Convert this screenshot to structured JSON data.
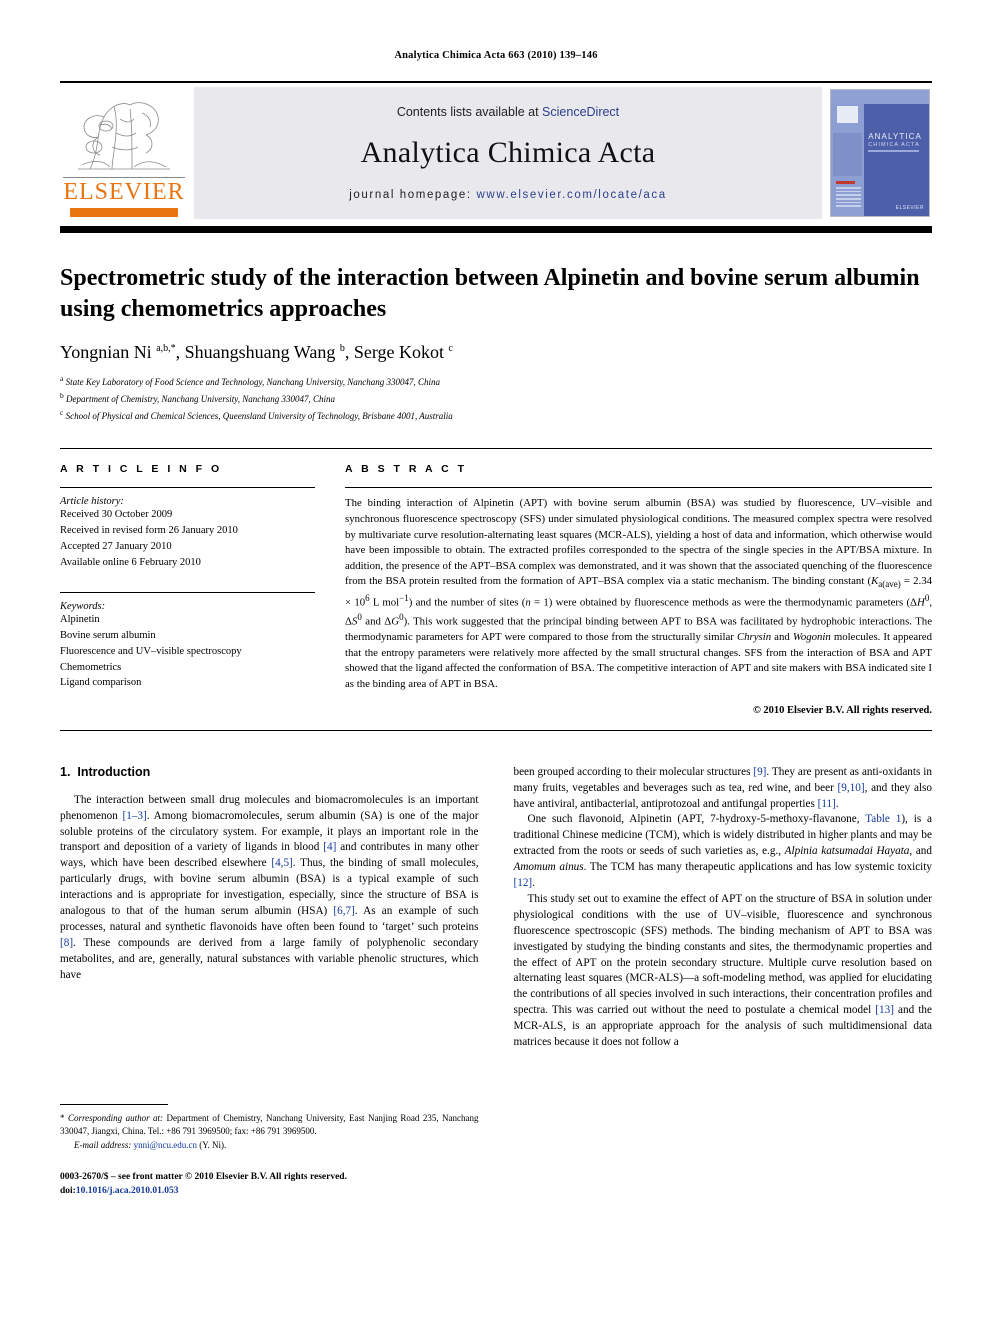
{
  "running_head": "Analytica Chimica Acta 663 (2010) 139–146",
  "masthead": {
    "contents_prefix": "Contents lists available at ",
    "sciencedirect": "ScienceDirect",
    "journal_title": "Analytica Chimica Acta",
    "homepage_label": "journal homepage:",
    "homepage_url": "www.elsevier.com/locate/aca",
    "publisher_logo_text": "ELSEVIER",
    "cover_title_line1": "ANALYTICA",
    "cover_title_line2": "CHIMICA ACTA",
    "cover_publisher": "ELSEVIER",
    "accent_orange": "#E87511",
    "link_blue": "#2b3f8c",
    "masthead_bg": "#e9e9ed"
  },
  "article": {
    "title": "Spectrometric study of the interaction between Alpinetin and bovine serum albumin using chemometrics approaches",
    "authors_html": "Yongnian Ni <sup>a,b,</sup><sup>*</sup>, Shuangshuang Wang <sup>b</sup>, Serge Kokot <sup>c</sup>",
    "affiliations": [
      "State Key Laboratory of Food Science and Technology, Nanchang University, Nanchang 330047, China",
      "Department of Chemistry, Nanchang University, Nanchang 330047, China",
      "School of Physical and Chemical Sciences, Queensland University of Technology, Brisbane 4001, Australia"
    ],
    "affiliation_marks": [
      "a",
      "b",
      "c"
    ]
  },
  "article_info": {
    "heading": "A R T I C L E    I N F O",
    "history_title": "Article history:",
    "history": [
      "Received 30 October 2009",
      "Received in revised form 26 January 2010",
      "Accepted 27 January 2010",
      "Available online 6 February 2010"
    ],
    "keywords_title": "Keywords:",
    "keywords": [
      "Alpinetin",
      "Bovine serum albumin",
      "Fluorescence and UV–visible spectroscopy",
      "Chemometrics",
      "Ligand comparison"
    ]
  },
  "abstract": {
    "heading": "A B S T R A C T",
    "text_html": "The binding interaction of Alpinetin (APT) with bovine serum albumin (BSA) was studied by fluorescence, UV–visible and synchronous fluorescence spectroscopy (SFS) under simulated physiological conditions. The measured complex spectra were resolved by multivariate curve resolution-alternating least squares (MCR-ALS), yielding a host of data and information, which otherwise would have been impossible to obtain. The extracted profiles corresponded to the spectra of the single species in the APT/BSA mixture. In addition, the presence of the APT–BSA complex was demonstrated, and it was shown that the associated quenching of the fluorescence from the BSA protein resulted from the formation of APT–BSA complex via a static mechanism. The binding constant (<i>K</i><sub>a(ave)</sub> = 2.34 &times; 10<sup>6</sup> L mol<sup>&minus;1</sup>) and the number of sites (<i>n</i> = 1) were obtained by fluorescence methods as were the thermodynamic parameters (&Delta;<i>H</i><sup>0</sup>, &Delta;<i>S</i><sup>0</sup> and &Delta;<i>G</i><sup>0</sup>). This work suggested that the principal binding between APT to BSA was facilitated by hydrophobic interactions. The thermodynamic parameters for APT were compared to those from the structurally similar <i>Chrysin</i> and <i>Wogonin</i> molecules. It appeared that the entropy parameters were relatively more affected by the small structural changes. SFS from the interaction of BSA and APT showed that the ligand affected the conformation of BSA. The competitive interaction of APT and site makers with BSA indicated site I as the binding area of APT in BSA.",
    "copyright": "© 2010 Elsevier B.V. All rights reserved."
  },
  "body": {
    "section_number": "1.",
    "section_title": "Introduction",
    "left_paragraphs_html": [
      "The interaction between small drug molecules and biomacromolecules is an important phenomenon <a class=\"ref\" href=\"#\">[1–3]</a>. Among biomacromolecules, serum albumin (SA) is one of the major soluble proteins of the circulatory system. For example, it plays an important role in the transport and deposition of a variety of ligands in blood <a class=\"ref\" href=\"#\">[4]</a> and contributes in many other ways, which have been described elsewhere <a class=\"ref\" href=\"#\">[4,5]</a>. Thus, the binding of small molecules, particularly drugs, with bovine serum albumin (BSA) is a typical example of such interactions and is appropriate for investigation, especially, since the structure of BSA is analogous to that of the human serum albumin (HSA) <a class=\"ref\" href=\"#\">[6,7]</a>. As an example of such processes, natural and synthetic flavonoids have often been found to ‘target’ such proteins <a class=\"ref\" href=\"#\">[8]</a>. These compounds are derived from a large family of polyphenolic secondary metabolites, and are, generally, natural substances with variable phenolic structures, which have"
    ],
    "right_paragraphs_html": [
      "been grouped according to their molecular structures <a class=\"ref\" href=\"#\">[9]</a>. They are present as anti-oxidants in many fruits, vegetables and beverages such as tea, red wine, and beer <a class=\"ref\" href=\"#\">[9,10]</a>, and they also have antiviral, antibacterial, antiprotozoal and antifungal properties <a class=\"ref\" href=\"#\">[11]</a>.",
      "One such flavonoid, Alpinetin (APT, 7-hydroxy-5-methoxy-flavanone, <a class=\"ref\" href=\"#\">Table 1</a>), is a traditional Chinese medicine (TCM), which is widely distributed in higher plants and may be extracted from the roots or seeds of such varieties as, e.g., <i>Alpinia katsumadai Hayata</i>, and <i>Amomum ainus</i>. The TCM has many therapeutic applications and has low systemic toxicity <a class=\"ref\" href=\"#\">[12]</a>.",
      "This study set out to examine the effect of APT on the structure of BSA in solution under physiological conditions with the use of UV–visible, fluorescence and synchronous fluorescence spectroscopic (SFS) methods. The binding mechanism of APT to BSA was investigated by studying the binding constants and sites, the thermodynamic properties and the effect of APT on the protein secondary structure. Multiple curve resolution based on alternating least squares (MCR-ALS)—a soft-modeling method, was applied for elucidating the contributions of all species involved in such interactions, their concentration profiles and spectra. This was carried out without the need to postulate a chemical model <a class=\"ref\" href=\"#\">[13]</a> and the MCR-ALS, is an appropriate approach for the analysis of such multidimensional data matrices because it does not follow a"
    ]
  },
  "footnotes": {
    "corresponding_html": "* <i>Corresponding author at:</i> Department of Chemistry, Nanchang University, East Nanjing Road 235, Nanchang 330047, Jiangxi, China. Tel.: +86 791 3969500; fax: +86 791 3969500.",
    "email_label": "E-mail address:",
    "email": "ynni@ncu.edu.cn",
    "email_suffix": "(Y. Ni).",
    "issn_line": "0003-2670/$ – see front matter © 2010 Elsevier B.V. All rights reserved.",
    "doi_label": "doi:",
    "doi": "10.1016/j.aca.2010.01.053"
  }
}
